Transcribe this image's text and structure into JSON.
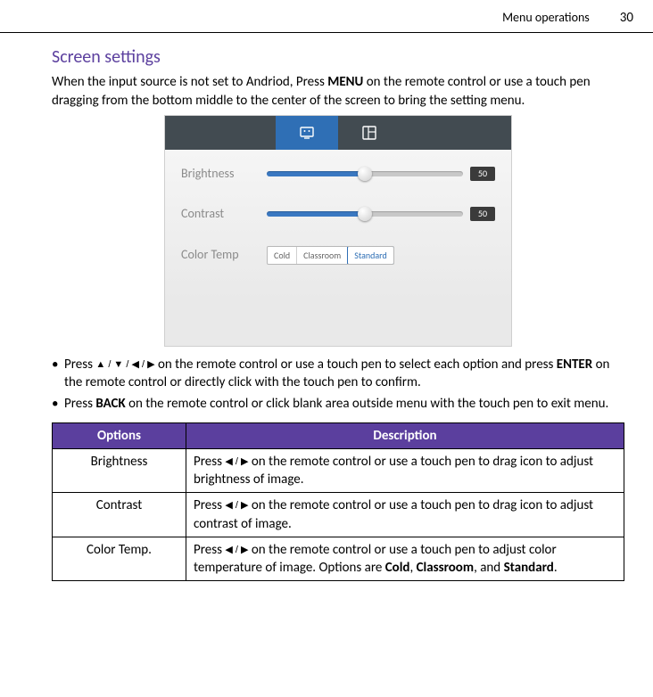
{
  "header": {
    "section": "Menu operations",
    "page": "30"
  },
  "title": "Screen settings",
  "intro_pre": "When the input source is not set to Andriod, Press ",
  "intro_menu": "MENU",
  "intro_post": " on the remote control or use a touch pen dragging from the bottom middle to the center of the screen to bring the setting menu.",
  "figure": {
    "rows": {
      "brightness": {
        "label": "Brightness",
        "value": "50"
      },
      "contrast": {
        "label": "Contrast",
        "value": "50"
      },
      "color_temp": {
        "label": "Color Temp",
        "options": [
          "Cold",
          "Classroom",
          "Standard"
        ],
        "selected": "Standard"
      }
    }
  },
  "bullets": {
    "b1_pre": "Press ",
    "b1_arrows": "▲ / ▼ / ◀ / ▶",
    "b1_mid": " on the remote control or use a touch pen to select each option  and press ",
    "b1_enter": "ENTER",
    "b1_post": " on the remote control or directly click with the touch pen to confirm.",
    "b2_pre": "Press ",
    "b2_back": "BACK",
    "b2_post": " on the remote control or click blank area outside menu with the touch pen to exit menu."
  },
  "table": {
    "head_options": "Options",
    "head_desc": "Description",
    "rows": [
      {
        "option": "Brightness",
        "desc_pre": "Press ",
        "desc_arrows": "◀ / ▶",
        "desc_post": " on the remote control or use a touch pen to drag icon to adjust brightness of image."
      },
      {
        "option": "Contrast",
        "desc_pre": "Press ",
        "desc_arrows": "◀ / ▶",
        "desc_post": " on the remote control or use a touch pen to drag icon to adjust contrast of image."
      },
      {
        "option": "Color Temp.",
        "desc_pre": "Press ",
        "desc_arrows": "◀ / ▶",
        "desc_mid": " on the remote control or use a touch pen to adjust color temperature of image. Options are ",
        "opt1": "Cold",
        "sep1": ", ",
        "opt2": "Classroom",
        "sep2": ", and ",
        "opt3": "Standard",
        "period": "."
      }
    ]
  }
}
